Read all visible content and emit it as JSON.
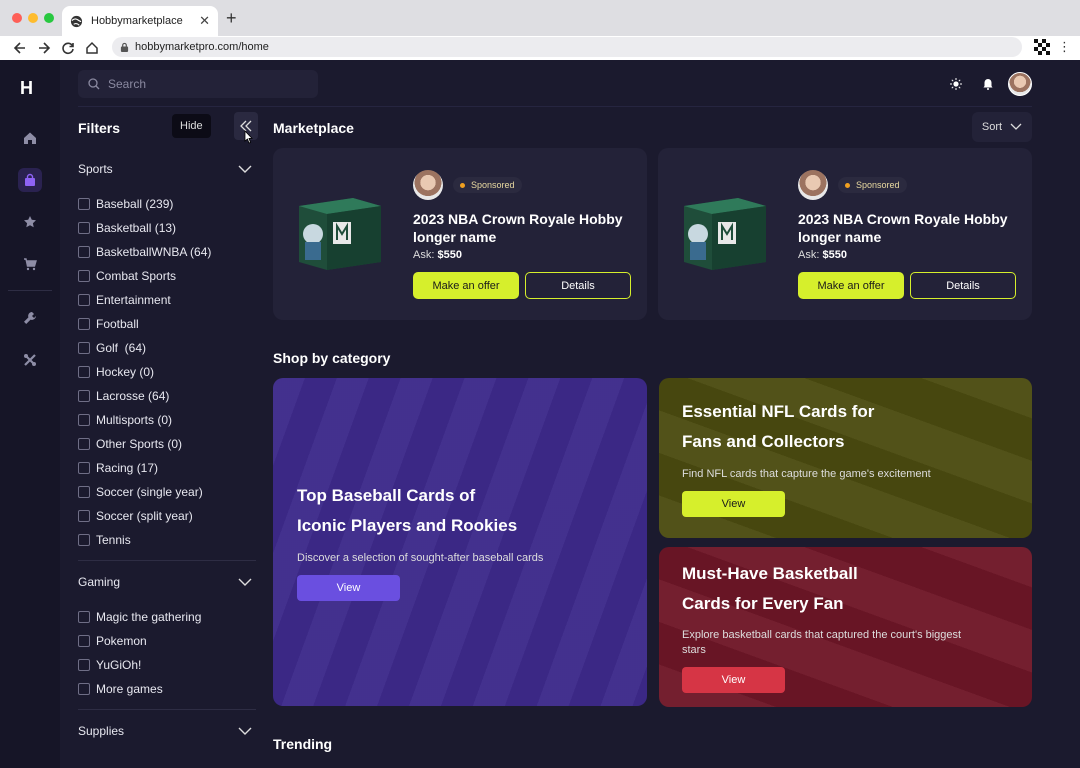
{
  "browser": {
    "tab_title": "Hobbymarketplace",
    "url": "hobbymarketpro.com/home"
  },
  "rail": {
    "logo": "H",
    "items": [
      "home-icon",
      "shopping-bag-icon",
      "star-icon",
      "cart-icon",
      "wrench-icon",
      "tools-icon"
    ]
  },
  "topbar": {
    "search_placeholder": "Search"
  },
  "filters": {
    "title": "Filters",
    "hide_tooltip": "Hide",
    "sports": {
      "label": "Sports",
      "items": [
        "Baseball (239)",
        "Basketball (13)",
        "BasketballWNBA (64)",
        "Combat Sports",
        "Entertainment",
        "Football",
        "Golf  (64)",
        "Hockey (0)",
        "Lacrosse (64)",
        "Multisports (0)",
        "Other Sports (0)",
        "Racing (17)",
        "Soccer (single year)",
        "Soccer (split year)",
        "Tennis"
      ]
    },
    "gaming": {
      "label": "Gaming",
      "items": [
        "Magic the gathering",
        "Pokemon",
        "YuGiOh!",
        "More games"
      ]
    },
    "supplies": {
      "label": "Supplies"
    }
  },
  "marketplace": {
    "title": "Marketplace",
    "sort_label": "Sort",
    "cards": [
      {
        "badge": "Sponsored",
        "title": "2023 NBA Crown Royale Hobby longer name",
        "ask_label": "Ask:",
        "ask_value": "$550",
        "offer_label": "Make an offer",
        "details_label": "Details"
      },
      {
        "badge": "Sponsored",
        "title": "2023 NBA Crown Royale Hobby longer name",
        "ask_label": "Ask:",
        "ask_value": "$550",
        "offer_label": "Make an offer",
        "details_label": "Details"
      }
    ]
  },
  "categories": {
    "title": "Shop by category",
    "baseball": {
      "title_line1": "Top Baseball Cards of",
      "title_line2": "Iconic Players and Rookies",
      "desc": "Discover a selection of sought-after baseball cards",
      "button": "View",
      "color": "#3d2a8a",
      "button_color": "#6a4fe0"
    },
    "nfl": {
      "title_line1": "Essential NFL Cards for",
      "title_line2": "Fans and Collectors",
      "desc": "Find NFL cards that capture the game's excitement",
      "button": "View",
      "color": "#4b4b10",
      "button_color": "#d6ef2c"
    },
    "basketball": {
      "title_line1": "Must-Have Basketball",
      "title_line2": "Cards for Every Fan",
      "desc_line1": "Explore basketball cards that captured the court's biggest",
      "desc_line2": "stars",
      "button": "View",
      "color": "#6e1627",
      "button_color": "#d63545"
    }
  },
  "trending": {
    "title": "Trending"
  },
  "colors": {
    "accent": "#d6ef2c",
    "background": "#1b1a2e",
    "panel": "#232238"
  }
}
